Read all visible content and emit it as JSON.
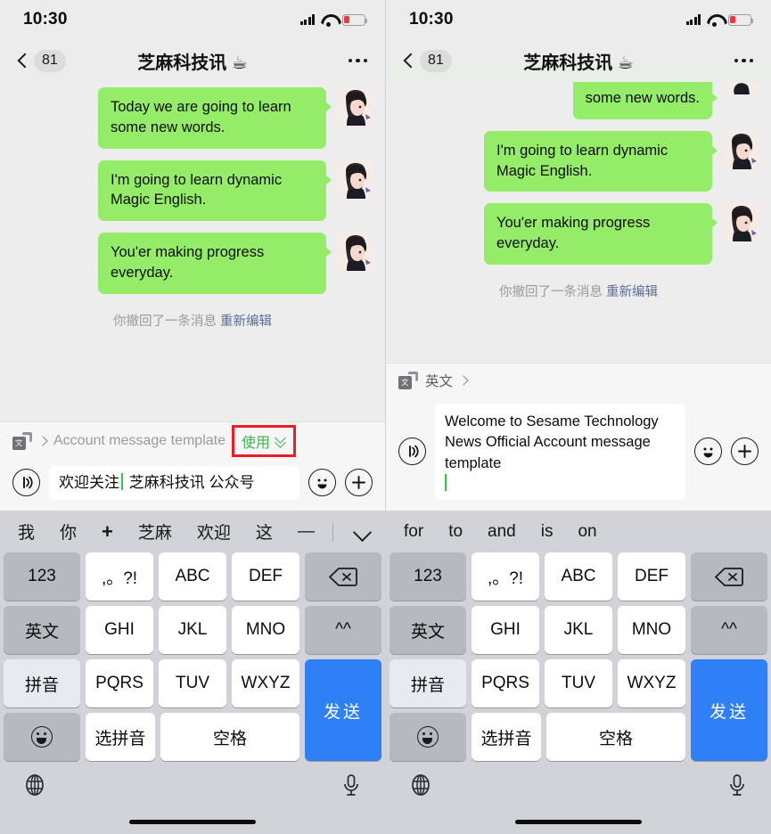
{
  "status": {
    "time": "10:30",
    "signal_icon": "cellular-bars-icon",
    "wifi_icon": "wifi-icon",
    "battery_icon": "battery-low-icon",
    "battery_color": "#f0373a"
  },
  "nav": {
    "back_icon": "chevron-left-icon",
    "unread_count": "81",
    "title": "芝麻科技讯 ☕",
    "more_icon": "more-dots-icon"
  },
  "colors": {
    "bubble_green": "#95EC69",
    "send_blue": "#2f7ff7",
    "use_green": "#3fb34f",
    "highlight_red": "#ee1c25",
    "keyboard_bg": "#d1d3d9",
    "chat_bg": "#ededed"
  },
  "left_phone": {
    "messages": [
      {
        "text": "Today we are going to learn some new words.",
        "avatar": "user-avatar",
        "clipped": false
      },
      {
        "text": "I'm going to learn dynamic Magic English.",
        "avatar": "user-avatar",
        "clipped": false
      },
      {
        "text": "You'er making progress everyday.",
        "avatar": "user-avatar",
        "clipped": false
      }
    ],
    "revoke_notice": "你撤回了一条消息",
    "revoke_action": "重新编辑",
    "translate_bar": {
      "icon": "translate-icon",
      "chevron_icon": "chevron-right-icon",
      "label": "Account message template",
      "use_label": "使用",
      "expand_icon": "double-chevron-down-icon",
      "highlighted": true
    },
    "input": {
      "voice_icon": "voice-input-icon",
      "value": "欢迎关注 芝麻科技讯 公众号",
      "cursor_after": "欢迎关注",
      "emoji_icon": "emoji-icon",
      "plus_icon": "plus-circle-icon"
    },
    "suggestions": [
      "我",
      "你",
      "+",
      "芝麻",
      "欢迎",
      "这",
      "—"
    ],
    "suggestion_collapse_icon": "chevron-down-icon"
  },
  "right_phone": {
    "messages": [
      {
        "text": "some new words.",
        "avatar": "user-avatar",
        "clipped": true
      },
      {
        "text": "I'm going to learn dynamic Magic English.",
        "avatar": "user-avatar",
        "clipped": false
      },
      {
        "text": "You'er making progress everyday.",
        "avatar": "user-avatar",
        "clipped": false
      }
    ],
    "revoke_notice": "你撤回了一条消息",
    "revoke_action": "重新编辑",
    "translate_bar": {
      "icon": "translate-icon",
      "chevron_icon": "chevron-right-icon",
      "label": "英文",
      "highlighted": false
    },
    "input": {
      "voice_icon": "voice-input-icon",
      "value": "Welcome to Sesame Technology News Official Account message template",
      "emoji_icon": "emoji-icon",
      "plus_icon": "plus-circle-icon"
    },
    "suggestions": [
      "for",
      "to",
      "and",
      "is",
      "on"
    ]
  },
  "keyboard": {
    "rows": [
      {
        "left": "123",
        "center": [
          ",。?!",
          "ABC",
          "DEF"
        ],
        "right": "backspace-icon"
      },
      {
        "left": "英文",
        "center": [
          "GHI",
          "JKL",
          "MNO"
        ],
        "right": "^^"
      },
      {
        "left": "拼音",
        "center": [
          "PQRS",
          "TUV",
          "WXYZ"
        ],
        "right": "发送"
      },
      {
        "left": "emoji-icon",
        "center": [
          "选拼音",
          "空格"
        ],
        "right": ""
      }
    ],
    "send_label": "发送",
    "left_keys": [
      "123",
      "英文",
      "拼音",
      "emoji-icon"
    ],
    "right_keys": [
      "backspace-icon",
      "^^",
      "发送"
    ],
    "center_keys": [
      ",。?!",
      "ABC",
      "DEF",
      "GHI",
      "JKL",
      "MNO",
      "PQRS",
      "TUV",
      "WXYZ",
      "选拼音",
      "空格"
    ]
  },
  "bottom": {
    "globe_icon": "globe-icon",
    "mic_icon": "microphone-icon",
    "home_indicator": "home-indicator"
  }
}
